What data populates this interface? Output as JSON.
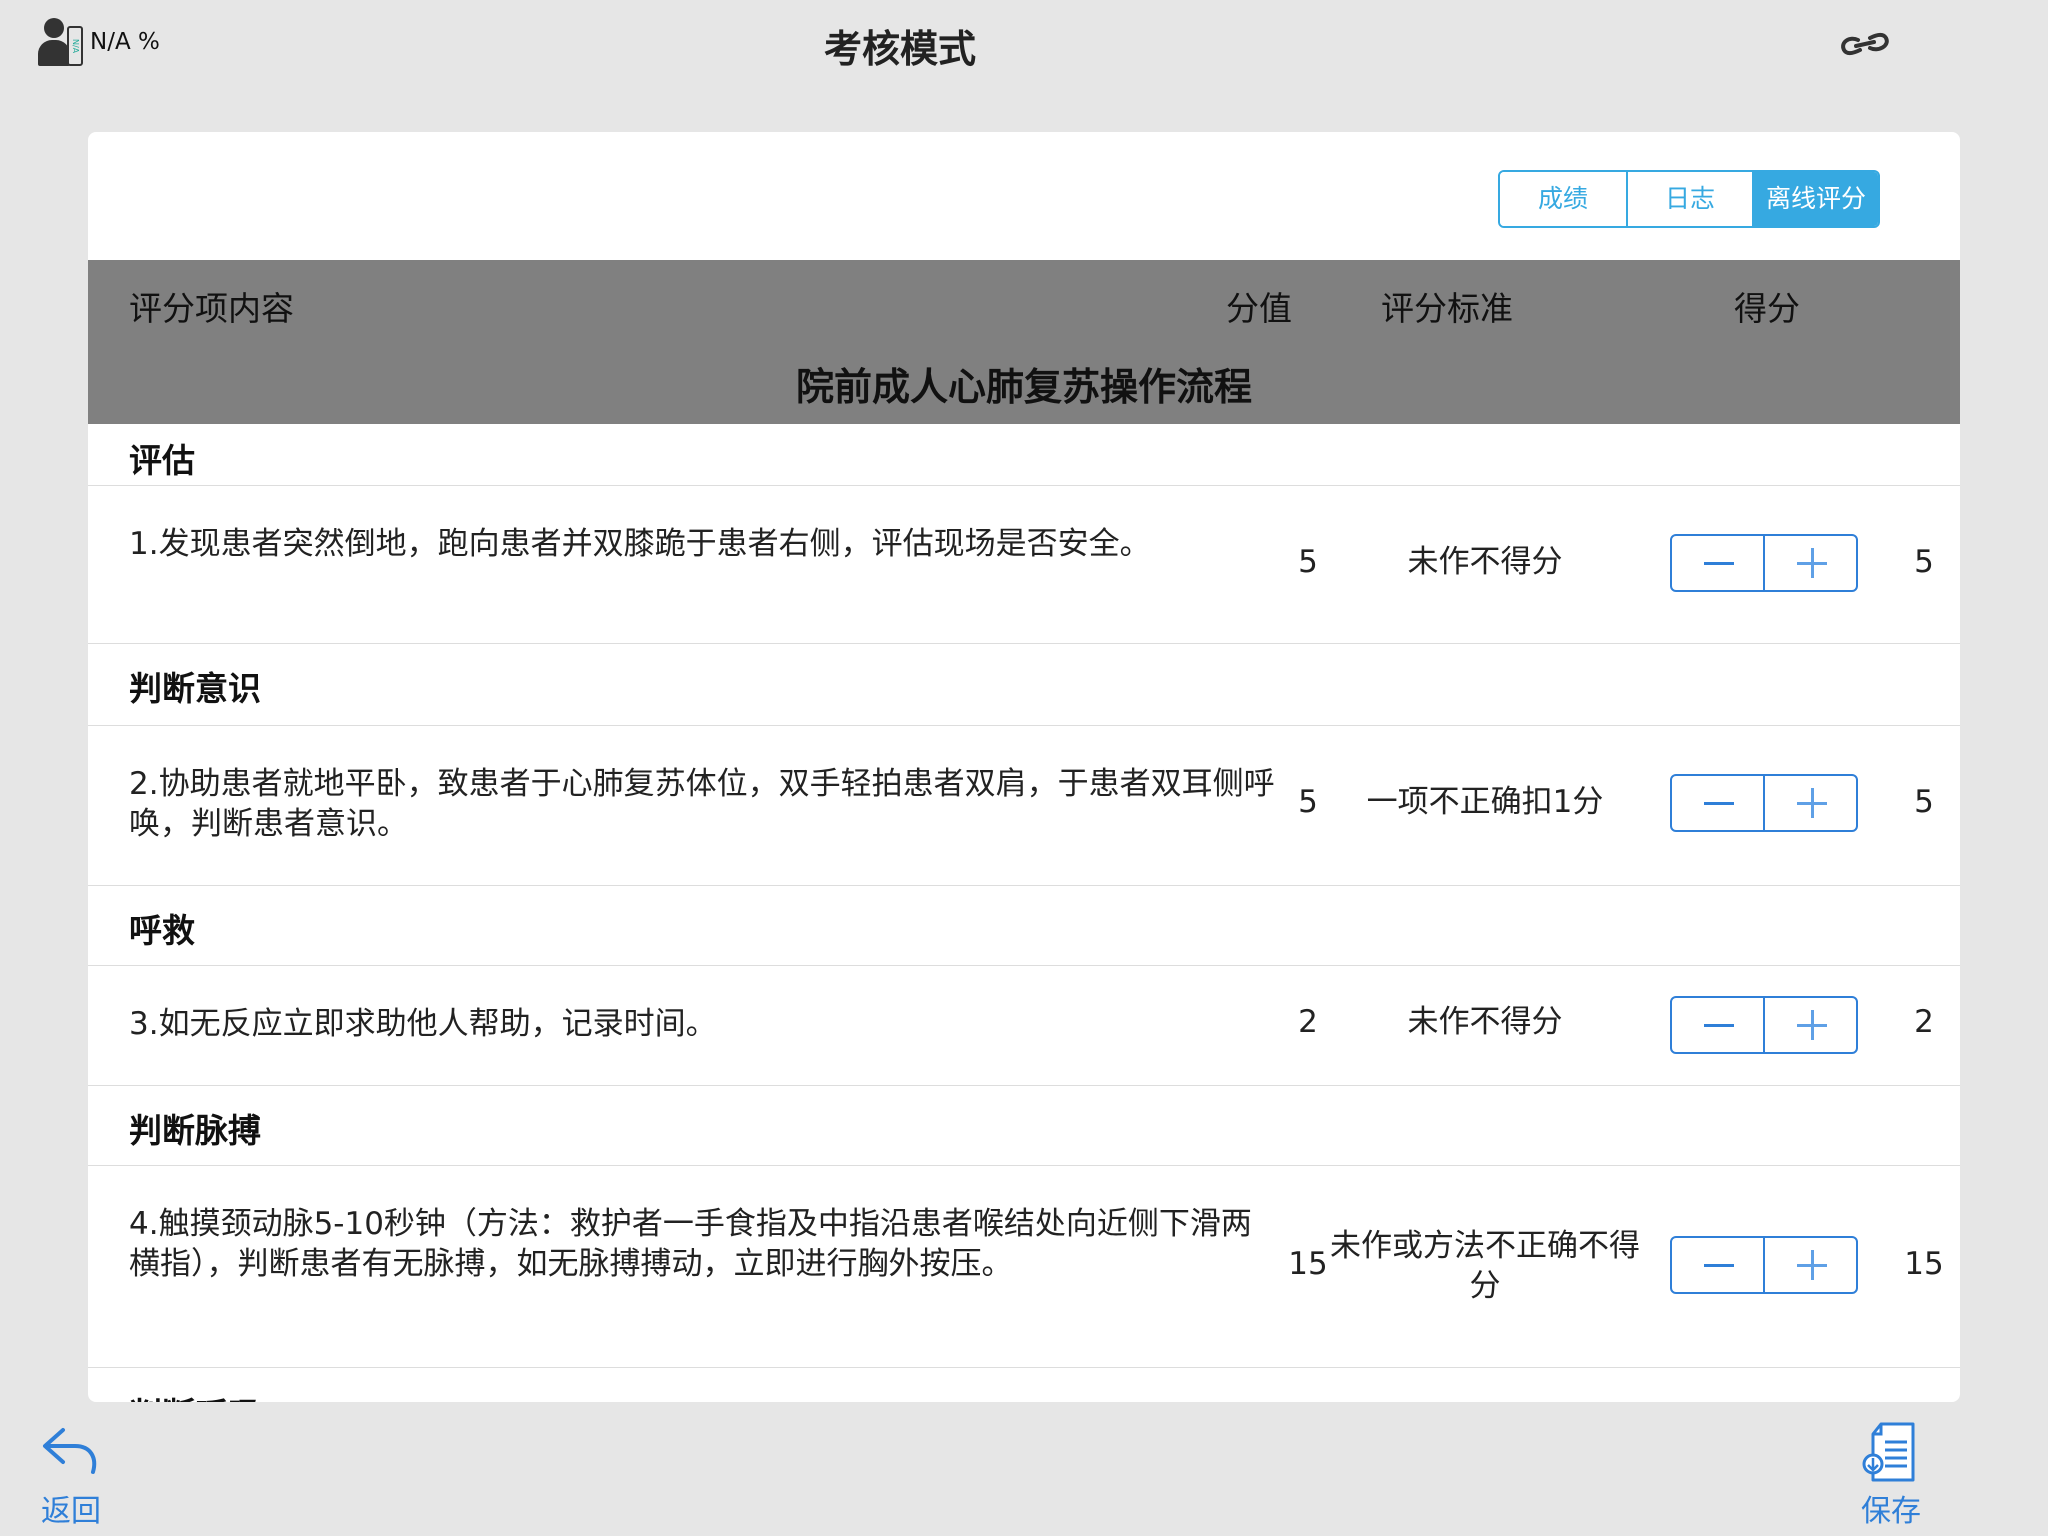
{
  "status": {
    "battery_text": "N/A %",
    "battery_badge": "N/A"
  },
  "title": "考核模式",
  "tabs": [
    {
      "label": "成绩"
    },
    {
      "label": "日志"
    },
    {
      "label": "离线评分"
    }
  ],
  "table": {
    "headers": {
      "content": "评分项内容",
      "value": "分值",
      "standard": "评分标准",
      "score": "得分"
    },
    "section_title": "院前成人心肺复苏操作流程"
  },
  "categories": [
    {
      "title": "评估",
      "item": {
        "text": "1.发现患者突然倒地，跑向患者并双膝跪于患者右侧，评估现场是否安全。",
        "value": "5",
        "standard": "未作不得分",
        "score": "5"
      }
    },
    {
      "title": "判断意识",
      "item": {
        "text": "2.协助患者就地平卧，致患者于心肺复苏体位，双手轻拍患者双肩，于患者双耳侧呼唤，判断患者意识。",
        "value": "5",
        "standard": "一项不正确扣1分",
        "score": "5"
      }
    },
    {
      "title": "呼救",
      "item": {
        "text": "3.如无反应立即求助他人帮助，记录时间。",
        "value": "2",
        "standard": "未作不得分",
        "score": "2"
      }
    },
    {
      "title": "判断脉搏",
      "item": {
        "text": "4.触摸颈动脉5-10秒钟（方法：救护者一手食指及中指沿患者喉结处向近侧下滑两横指），判断患者有无脉搏，如无脉搏搏动，立即进行胸外按压。",
        "value": "15",
        "standard": "未作或方法不正确不得分",
        "score": "15"
      }
    },
    {
      "title": "判断呼吸"
    }
  ],
  "bottom": {
    "back_label": "返回",
    "save_label": "保存"
  },
  "colors": {
    "accent": "#36a9e1",
    "stepper": "#2f7fd8",
    "header_bg": "#808080"
  }
}
